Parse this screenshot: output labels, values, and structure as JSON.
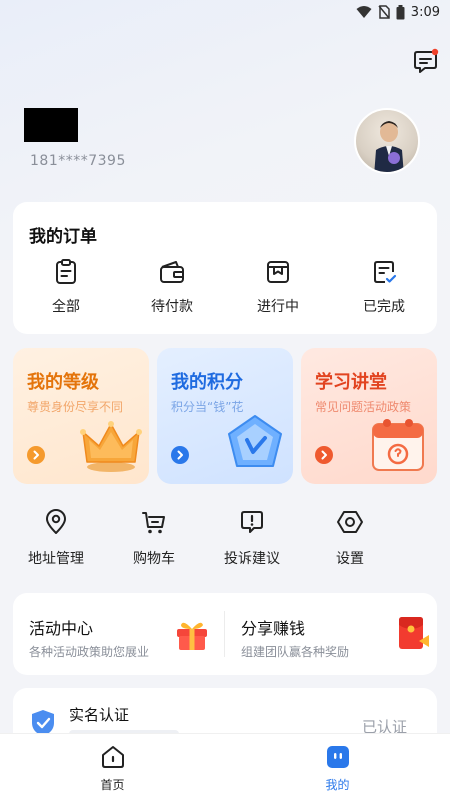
{
  "status_bar": {
    "time": "3:09"
  },
  "profile": {
    "phone": "181****7395"
  },
  "orders": {
    "title": "我的订单",
    "items": [
      {
        "label": "全部",
        "icon": "clipboard-icon"
      },
      {
        "label": "待付款",
        "icon": "wallet-icon"
      },
      {
        "label": "进行中",
        "icon": "bookmark-box-icon"
      },
      {
        "label": "已完成",
        "icon": "check-document-icon"
      }
    ]
  },
  "promos": [
    {
      "title": "我的等级",
      "subtitle": "尊贵身份尽享不同",
      "icon": "crown-icon",
      "accent": "#e4740b"
    },
    {
      "title": "我的积分",
      "subtitle": "积分当“钱”花",
      "icon": "points-badge-icon",
      "accent": "#1f6be0"
    },
    {
      "title": "学习讲堂",
      "subtitle": "常见问题活动政策",
      "icon": "calendar-icon",
      "accent": "#e24420"
    }
  ],
  "tools": [
    {
      "label": "地址管理",
      "icon": "location-pin-icon"
    },
    {
      "label": "购物车",
      "icon": "cart-icon"
    },
    {
      "label": "投诉建议",
      "icon": "feedback-icon"
    },
    {
      "label": "设置",
      "icon": "settings-hexagon-icon"
    }
  ],
  "activity": {
    "title": "活动中心",
    "subtitle": "各种活动政策助您展业",
    "icon": "gift-icon"
  },
  "share": {
    "title": "分享赚钱",
    "subtitle": "组建团队赢各种奖励",
    "icon": "red-envelope-icon"
  },
  "verify": {
    "title": "实名认证",
    "status": "已认证",
    "icon": "shield-check-icon"
  },
  "nav": {
    "items": [
      {
        "label": "首页",
        "icon": "home-icon",
        "active": false
      },
      {
        "label": "我的",
        "icon": "profile-icon",
        "active": true
      }
    ],
    "active_color": "#2a78ea"
  }
}
